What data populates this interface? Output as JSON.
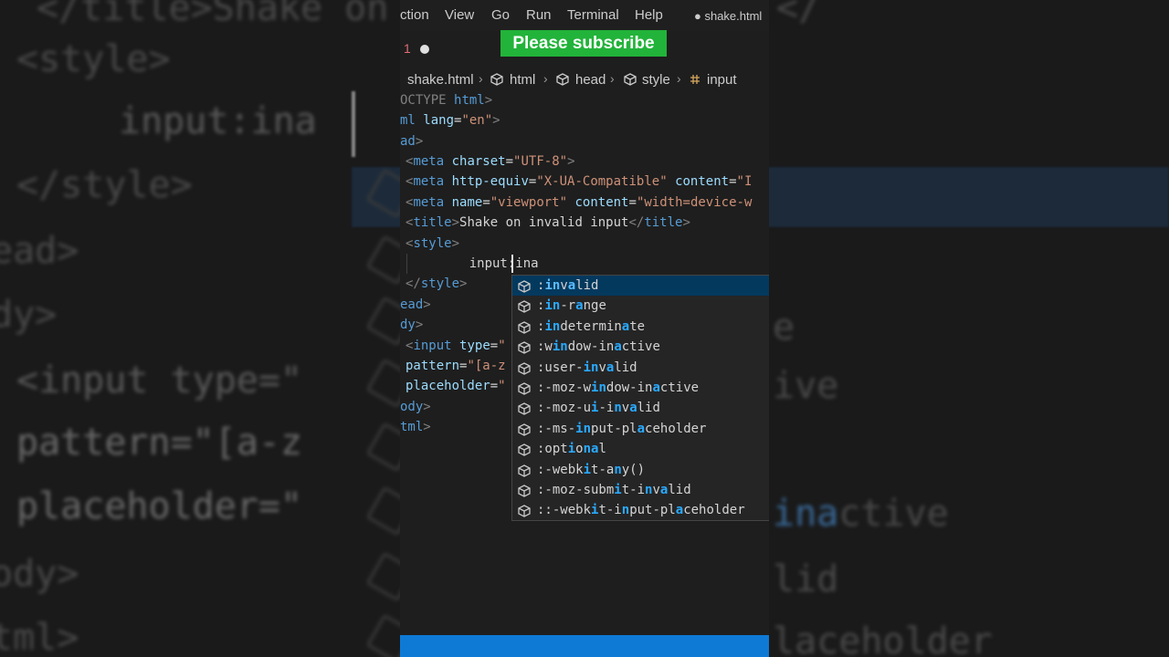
{
  "menubar": {
    "items": [
      "ction",
      "View",
      "Go",
      "Run",
      "Terminal",
      "Help"
    ],
    "tab_title": "● shake.html"
  },
  "tabbar": {
    "line_number": "1"
  },
  "overlay": {
    "subscribe_text": "Please subscribe"
  },
  "breadcrumb": {
    "file": "shake.html",
    "items": [
      "html",
      "head",
      "style",
      "input"
    ]
  },
  "code": {
    "lines": [
      "OCTYPE html>",
      "ml lang=\"en\">",
      "ad>",
      "<meta charset=\"UTF-8\">",
      "<meta http-equiv=\"X-UA-Compatible\" content=\"I",
      "<meta name=\"viewport\" content=\"width=device-w",
      "<title>Shake on invalid input</title>",
      "<style>",
      "    input:ina",
      "</style>",
      "ead>",
      "dy>",
      "<input type=\"",
      "pattern=\"[a-z",
      "placeholder=\"",
      "ody>",
      "tml>"
    ]
  },
  "suggestions": [
    {
      "label": ":invalid",
      "selected": true
    },
    {
      "label": ":in-range",
      "selected": false
    },
    {
      "label": ":indeterminate",
      "selected": false
    },
    {
      "label": ":window-inactive",
      "selected": false
    },
    {
      "label": ":user-invalid",
      "selected": false
    },
    {
      "label": ":-moz-window-inactive",
      "selected": false
    },
    {
      "label": ":-moz-ui-invalid",
      "selected": false
    },
    {
      "label": ":-ms-input-placeholder",
      "selected": false
    },
    {
      "label": ":optional",
      "selected": false
    },
    {
      "label": ":-webkit-any()",
      "selected": false
    },
    {
      "label": ":-moz-submit-invalid",
      "selected": false
    },
    {
      "label": "::-webkit-input-placeholder",
      "selected": false
    }
  ],
  "background": {
    "left_lines": [
      "</title>Shake on",
      "<style>",
      "input:ina",
      "</style>",
      "ead>",
      "dy>",
      "<input type=\"",
      "pattern=\"[a-z",
      "placeholder=\"",
      "ody>",
      "tml>"
    ],
    "right_lines": [
      "</",
      "e",
      "ive",
      "inactive",
      "lid",
      "laceholder"
    ]
  },
  "colors": {
    "accent": "#0e7ad5",
    "selection": "#04395e",
    "subscribe_bg": "#22b33a",
    "match": "#2aaaff"
  }
}
